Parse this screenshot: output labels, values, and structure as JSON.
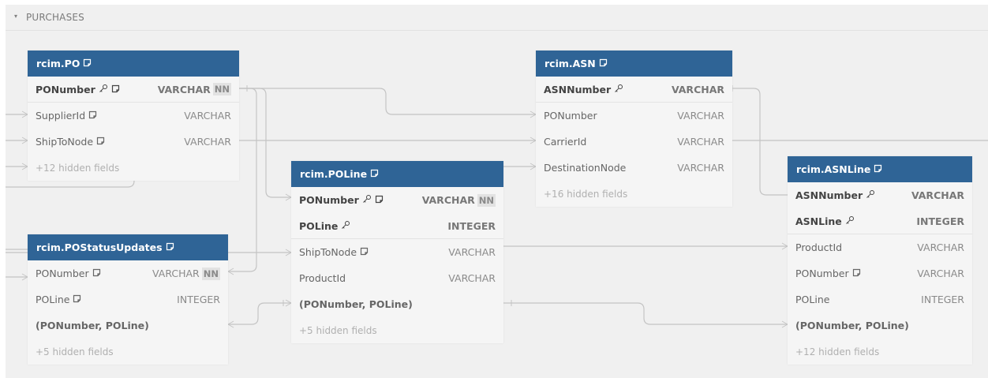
{
  "group": {
    "toggle": "▾",
    "title": "PURCHASES"
  },
  "tables": [
    {
      "id": "po",
      "title": "rcim.PO",
      "note": true,
      "rows": [
        {
          "kind": "field",
          "name": "PONumber",
          "type": "VARCHAR",
          "pk": true,
          "key_icon": true,
          "note_icon": true,
          "nn": "NN"
        },
        {
          "kind": "field",
          "name": "SupplierId",
          "type": "VARCHAR",
          "note_icon": true
        },
        {
          "kind": "field",
          "name": "ShipToNode",
          "type": "VARCHAR",
          "note_icon": true
        },
        {
          "kind": "hidden",
          "name": "+12 hidden fields"
        }
      ]
    },
    {
      "id": "postatus",
      "title": "rcim.POStatusUpdates",
      "note": true,
      "rows": [
        {
          "kind": "field",
          "name": "PONumber",
          "type": "VARCHAR",
          "note_icon": true,
          "nn": "NN"
        },
        {
          "kind": "field",
          "name": "POLine",
          "type": "INTEGER",
          "note_icon": true
        },
        {
          "kind": "index",
          "name": "(PONumber, POLine)"
        },
        {
          "kind": "hidden",
          "name": "+5 hidden fields"
        }
      ]
    },
    {
      "id": "poline",
      "title": "rcim.POLine",
      "note": true,
      "rows": [
        {
          "kind": "field",
          "name": "PONumber",
          "type": "VARCHAR",
          "pk": true,
          "key_icon": true,
          "note_icon": true,
          "nn": "NN"
        },
        {
          "kind": "field",
          "name": "POLine",
          "type": "INTEGER",
          "pk": true,
          "key_icon": true
        },
        {
          "kind": "field",
          "name": "ShipToNode",
          "type": "VARCHAR",
          "note_icon": true
        },
        {
          "kind": "field",
          "name": "ProductId",
          "type": "VARCHAR"
        },
        {
          "kind": "index",
          "name": "(PONumber, POLine)"
        },
        {
          "kind": "hidden",
          "name": "+5 hidden fields"
        }
      ]
    },
    {
      "id": "asn",
      "title": "rcim.ASN",
      "note": true,
      "rows": [
        {
          "kind": "field",
          "name": "ASNNumber",
          "type": "VARCHAR",
          "pk": true,
          "key_icon": true
        },
        {
          "kind": "field",
          "name": "PONumber",
          "type": "VARCHAR"
        },
        {
          "kind": "field",
          "name": "CarrierId",
          "type": "VARCHAR"
        },
        {
          "kind": "field",
          "name": "DestinationNode",
          "type": "VARCHAR"
        },
        {
          "kind": "hidden",
          "name": "+16 hidden fields"
        }
      ]
    },
    {
      "id": "asnline",
      "title": "rcim.ASNLine",
      "note": true,
      "rows": [
        {
          "kind": "field",
          "name": "ASNNumber",
          "type": "VARCHAR",
          "pk": true,
          "key_icon": true
        },
        {
          "kind": "field",
          "name": "ASNLine",
          "type": "INTEGER",
          "pk": true,
          "key_icon": true
        },
        {
          "kind": "field",
          "name": "ProductId",
          "type": "VARCHAR"
        },
        {
          "kind": "field",
          "name": "PONumber",
          "type": "VARCHAR",
          "note_icon": true
        },
        {
          "kind": "field",
          "name": "POLine",
          "type": "INTEGER"
        },
        {
          "kind": "index",
          "name": "(PONumber, POLine)"
        },
        {
          "kind": "hidden",
          "name": "+12 hidden fields"
        }
      ]
    }
  ],
  "colors": {
    "header": "#2f6496",
    "canvas": "#f0f0f0",
    "edge": "#c4c4c4"
  }
}
